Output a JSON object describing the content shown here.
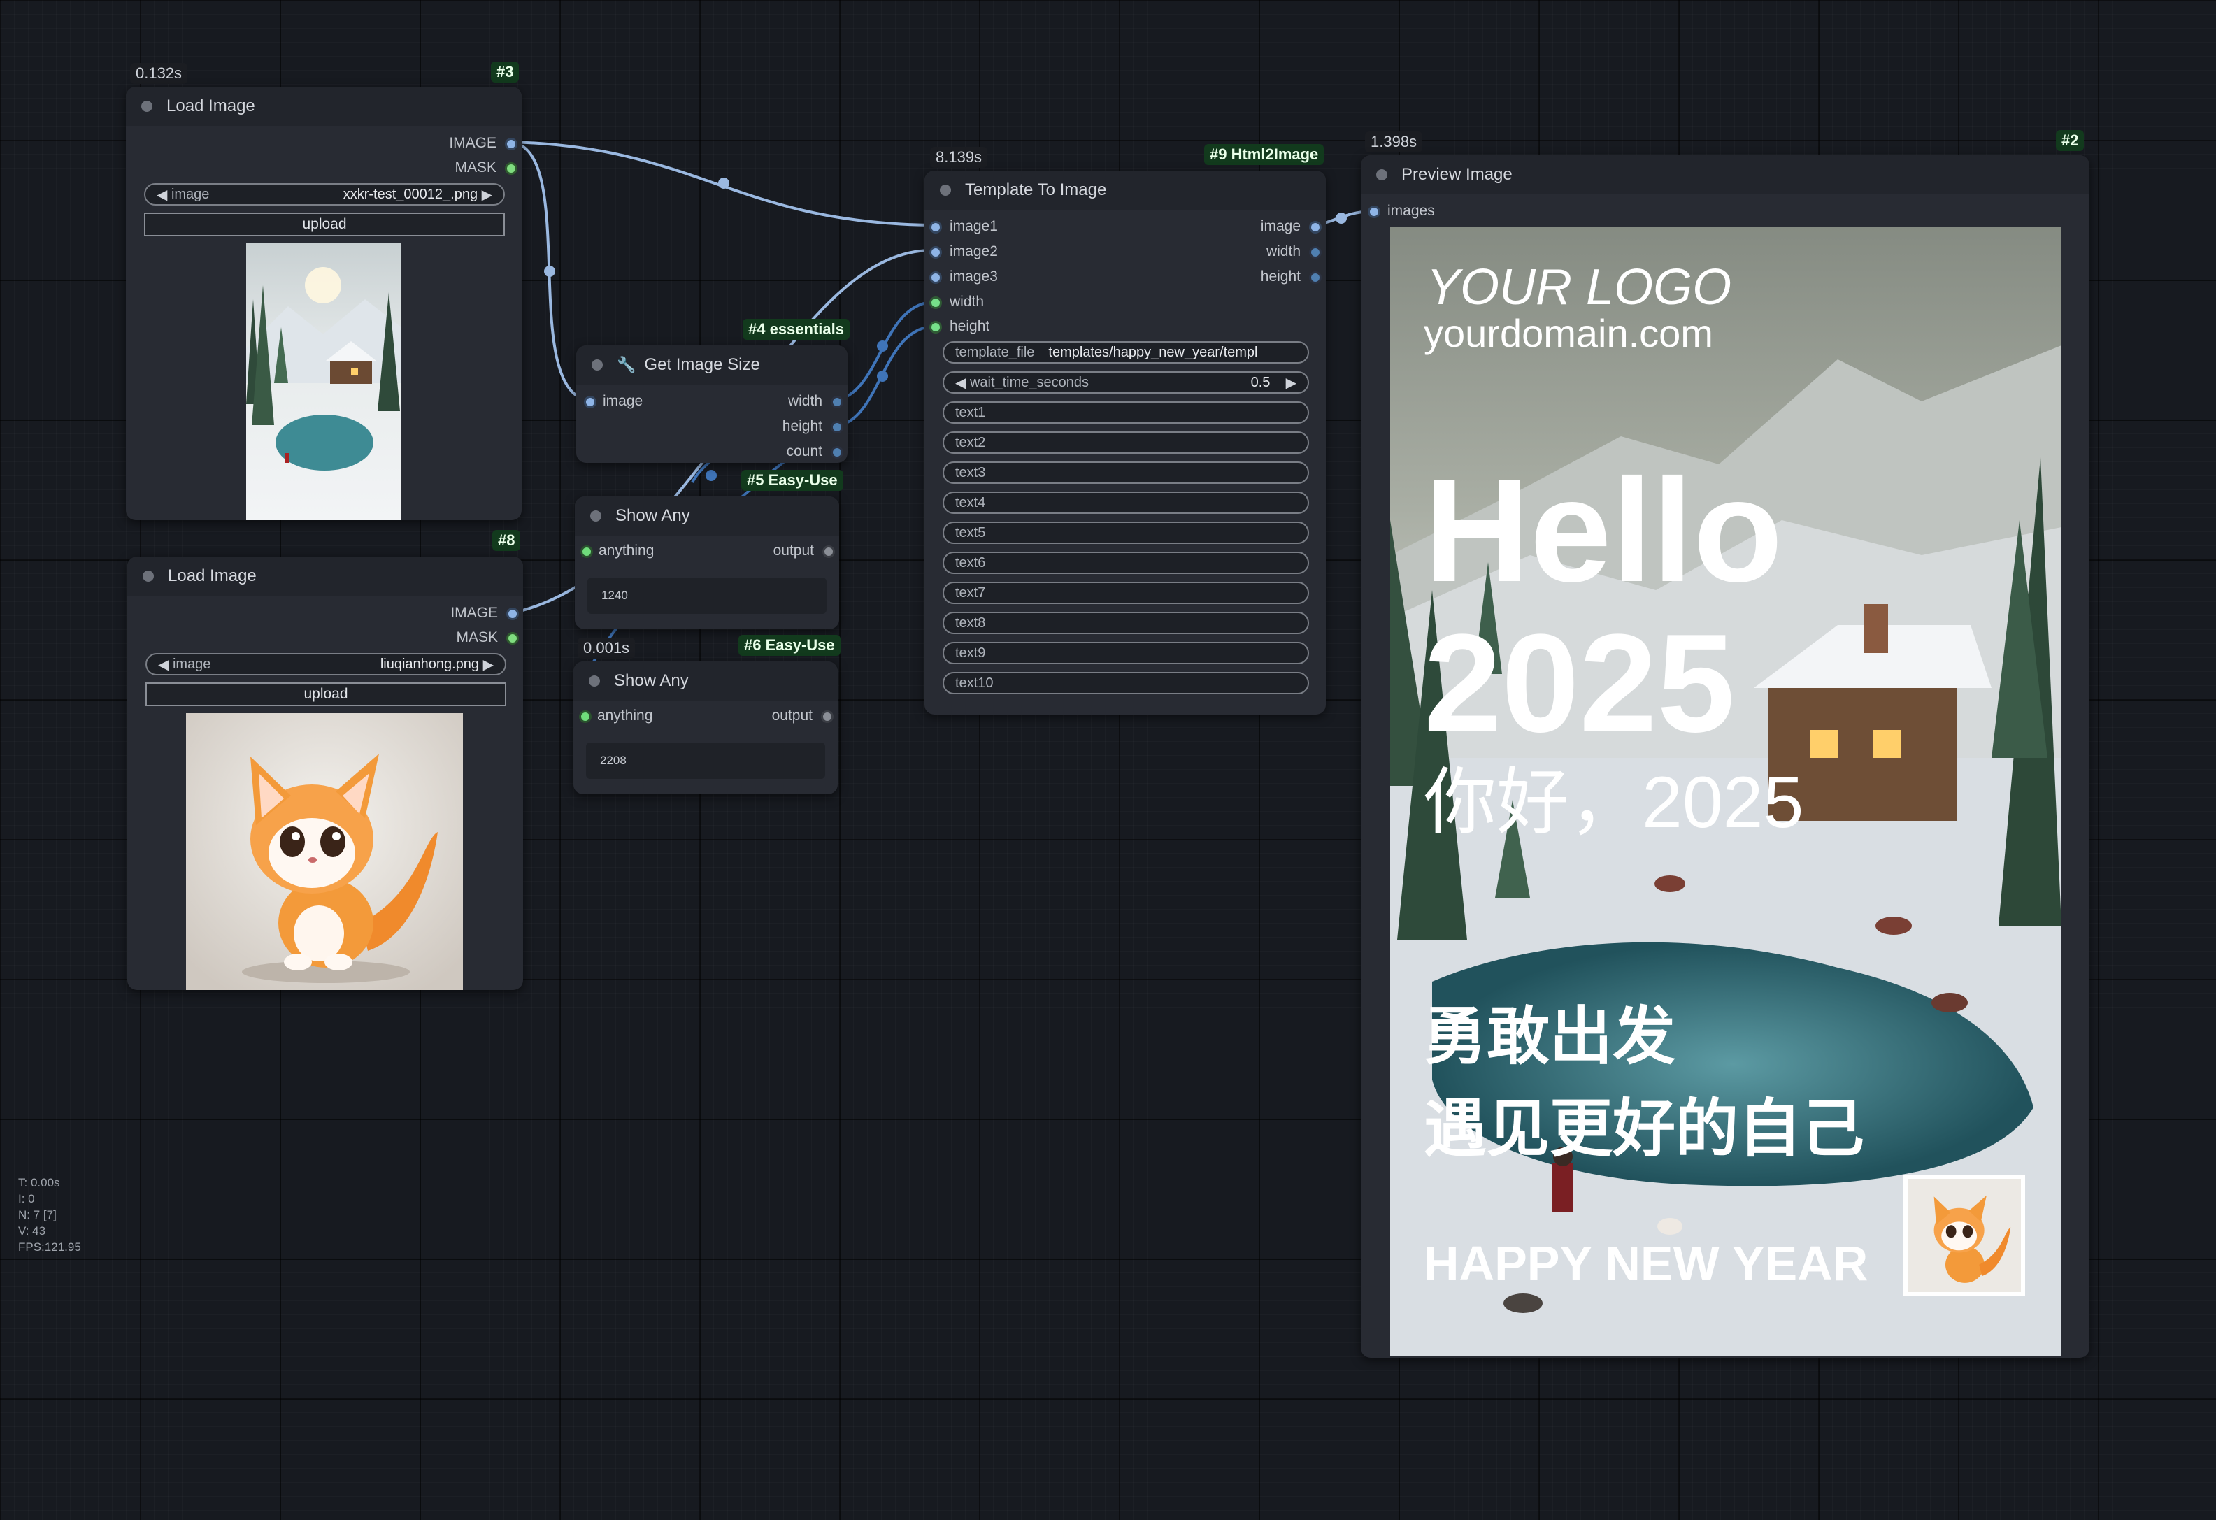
{
  "nodes": {
    "load1": {
      "time": "0.132s",
      "id": "#3",
      "title": "Load Image",
      "out_image": "IMAGE",
      "out_mask": "MASK",
      "image_label": "image",
      "image_value": "xxkr-test_00012_.png",
      "upload": "upload"
    },
    "load2": {
      "id": "#8",
      "title": "Load Image",
      "out_image": "IMAGE",
      "out_mask": "MASK",
      "image_label": "image",
      "image_value": "liuqianhong.png",
      "upload": "upload"
    },
    "size": {
      "id": "#4 essentials",
      "title": "Get Image Size",
      "in_image": "image",
      "out_width": "width",
      "out_height": "height",
      "out_count": "count"
    },
    "show1": {
      "id": "#5 Easy-Use",
      "title": "Show Any",
      "in": "anything",
      "out": "output",
      "value": "1240"
    },
    "show2": {
      "time": "0.001s",
      "id": "#6 Easy-Use",
      "title": "Show Any",
      "in": "anything",
      "out": "output",
      "value": "2208"
    },
    "tmpl": {
      "time": "8.139s",
      "id": "#9 Html2Image",
      "title": "Template To Image",
      "inputs": [
        "image1",
        "image2",
        "image3",
        "width",
        "height"
      ],
      "outputs": [
        "image",
        "width",
        "height"
      ],
      "template_label": "template_file",
      "template_value": "templates/happy_new_year/templ",
      "wait_label": "wait_time_seconds",
      "wait_value": "0.5",
      "texts": [
        "text1",
        "text2",
        "text3",
        "text4",
        "text5",
        "text6",
        "text7",
        "text8",
        "text9",
        "text10"
      ]
    },
    "preview": {
      "time": "1.398s",
      "id": "#2",
      "title": "Preview Image",
      "in": "images",
      "poster": {
        "logo": "YOUR LOGO",
        "domain": "yourdomain.com",
        "hello": "Hello",
        "year": "2025",
        "cn_greeting": "你好，2025",
        "cn_line1": "勇敢出发",
        "cn_line2": "遇见更好的自己",
        "footer": "HAPPY NEW YEAR"
      }
    }
  },
  "stats": {
    "t": "T: 0.00s",
    "i": "I: 0",
    "n": "N: 7 [7]",
    "v": "V: 43",
    "fps": "FPS:121.95"
  }
}
